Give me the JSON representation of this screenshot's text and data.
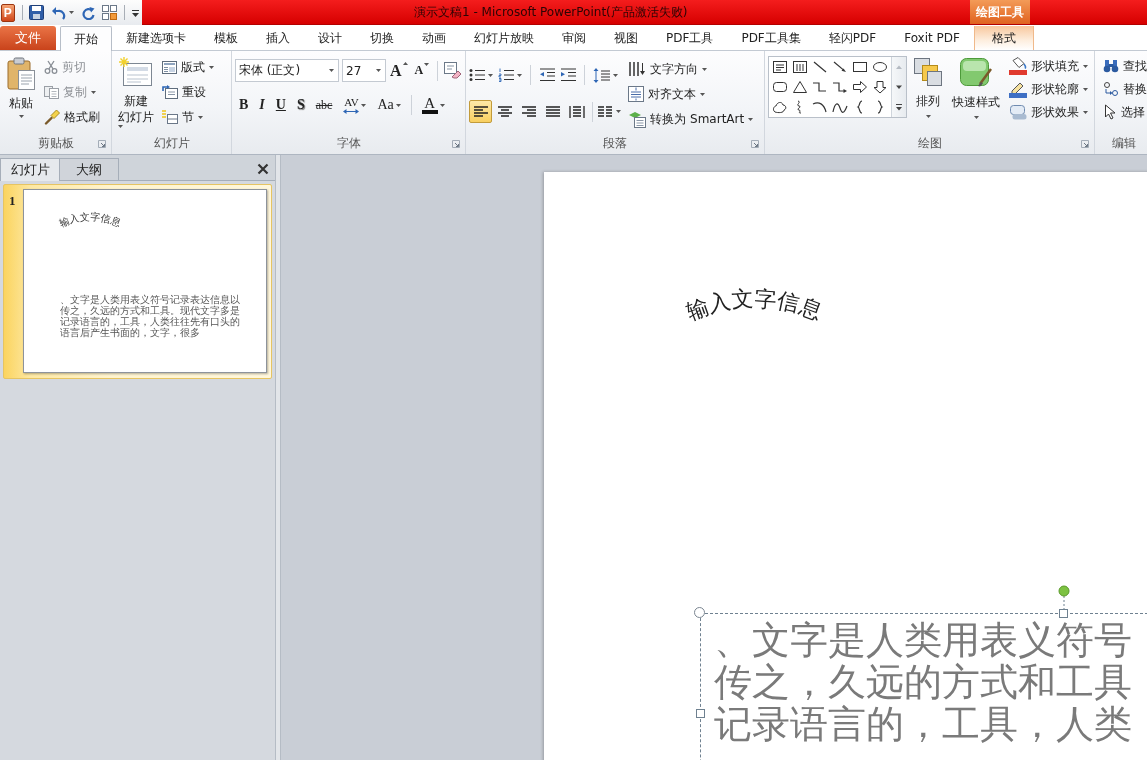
{
  "title_bar": {
    "app_logo": "P",
    "title": "演示文稿1 - Microsoft PowerPoint(产品激活失败)",
    "context_header": "绘图工具"
  },
  "tabs": [
    {
      "label": "文件",
      "kind": "file",
      "selected": false
    },
    {
      "label": "开始",
      "kind": "tab",
      "selected": true
    },
    {
      "label": "新建选项卡",
      "kind": "tab",
      "selected": false
    },
    {
      "label": "模板",
      "kind": "tab",
      "selected": false
    },
    {
      "label": "插入",
      "kind": "tab",
      "selected": false
    },
    {
      "label": "设计",
      "kind": "tab",
      "selected": false
    },
    {
      "label": "切换",
      "kind": "tab",
      "selected": false
    },
    {
      "label": "动画",
      "kind": "tab",
      "selected": false
    },
    {
      "label": "幻灯片放映",
      "kind": "tab",
      "selected": false
    },
    {
      "label": "审阅",
      "kind": "tab",
      "selected": false
    },
    {
      "label": "视图",
      "kind": "tab",
      "selected": false
    },
    {
      "label": "PDF工具",
      "kind": "tab",
      "selected": false
    },
    {
      "label": "PDF工具集",
      "kind": "tab",
      "selected": false
    },
    {
      "label": "轻闪PDF",
      "kind": "tab",
      "selected": false
    },
    {
      "label": "Foxit PDF",
      "kind": "tab",
      "selected": false
    },
    {
      "label": "格式",
      "kind": "context",
      "selected": false
    }
  ],
  "ribbon": {
    "clipboard": {
      "label": "剪贴板",
      "paste": "粘贴",
      "cut": {
        "label": "剪切",
        "disabled": true
      },
      "copy": {
        "label": "复制",
        "disabled": true
      },
      "format_painter": {
        "label": "格式刷",
        "disabled": false
      }
    },
    "slides": {
      "label": "幻灯片",
      "new_slide": [
        "新建",
        "幻灯片"
      ],
      "layout": "版式",
      "reset": "重设",
      "section": "节"
    },
    "font": {
      "label": "字体",
      "font_name": "宋体 (正文)",
      "font_size": "27",
      "grow": "A",
      "shrink": "A",
      "styles": [
        {
          "label": "B",
          "kind": "bold"
        },
        {
          "label": "I",
          "kind": "italic"
        },
        {
          "label": "U",
          "kind": "underline"
        },
        {
          "label": "S",
          "kind": "shadow"
        },
        {
          "label": "abc",
          "kind": "strike"
        },
        {
          "label": "AV",
          "kind": "spacing"
        },
        {
          "label": "Aa",
          "kind": "case"
        },
        {
          "label": "A",
          "kind": "color"
        }
      ]
    },
    "paragraph": {
      "label": "段落",
      "text_direction": "文字方向",
      "align_text": "对齐文本",
      "smartart": "转换为 SmartArt",
      "alignments": [
        {
          "kind": "left",
          "selected": true
        },
        {
          "kind": "center",
          "selected": false
        },
        {
          "kind": "right",
          "selected": false
        },
        {
          "kind": "justify",
          "selected": false
        },
        {
          "kind": "distribute",
          "selected": false
        }
      ]
    },
    "drawing": {
      "label": "绘图",
      "arrange": "排列",
      "quick_styles": "快速样式",
      "fill": "形状填充",
      "outline": "形状轮廓",
      "effects": "形状效果"
    },
    "editing": {
      "label": "编辑",
      "find": "查找",
      "replace": "替换",
      "select": "选择"
    }
  },
  "panel": {
    "tabs": [
      {
        "label": "幻灯片",
        "selected": true
      },
      {
        "label": "大纲",
        "selected": false
      }
    ]
  },
  "thumbnails": [
    {
      "number": "1",
      "selected": true,
      "title": "输入文字信息",
      "body": "、文字是人类用表义符号记录表达信息以传之，久远的方式和工具。现代文字多是记录语言的，工具，人类往往先有口头的语言后产生书面的，文字，很多"
    }
  ],
  "slide": {
    "title": "输入文字信息",
    "body": {
      "selected": true,
      "lines": [
        "、文字是人类用表义符号",
        "传之，久远的方式和工具",
        "记录语言的，工具，人类"
      ]
    }
  }
}
